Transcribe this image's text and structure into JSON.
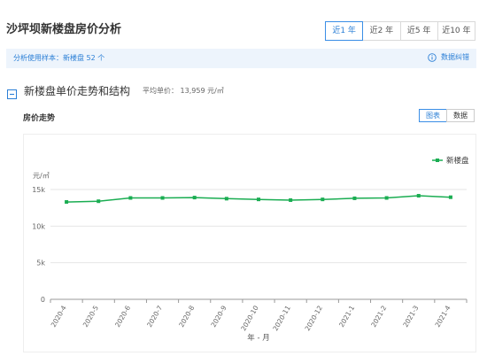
{
  "page": {
    "title": "沙坪坝新楼盘房价分析"
  },
  "range_tabs": [
    {
      "label": "近1 年",
      "active": true
    },
    {
      "label": "近2 年",
      "active": false
    },
    {
      "label": "近5 年",
      "active": false
    },
    {
      "label": "近10 年",
      "active": false
    }
  ],
  "info_bar": {
    "sample_text": "分析使用样本：新楼盘 52 个",
    "feedback_label": "数据纠错",
    "feedback_icon": "info-circle-icon"
  },
  "section": {
    "title": "新楼盘单价走势和结构",
    "collapse_icon": "collapse-minus-icon",
    "avg_price": "平均单价：  13,959 元/㎡"
  },
  "chart_panel": {
    "label": "房价走势",
    "view_buttons": [
      {
        "label": "图表",
        "active": true
      },
      {
        "label": "数据",
        "active": false
      }
    ]
  },
  "colors": {
    "accent": "#2b7fd6",
    "series": "#1aad52",
    "info_bg": "#edf4fc"
  },
  "chart_data": {
    "type": "line",
    "title": "",
    "xlabel": "年 - 月",
    "ylabel": "元/㎡",
    "categories": [
      "2020-4",
      "2020-5",
      "2020-6",
      "2020-7",
      "2020-8",
      "2020-9",
      "2020-10",
      "2020-11",
      "2020-12",
      "2021-1",
      "2021-2",
      "2021-3",
      "2021-4"
    ],
    "series": [
      {
        "name": "新楼盘",
        "values": [
          13300,
          13400,
          13850,
          13850,
          13900,
          13750,
          13650,
          13550,
          13650,
          13800,
          13850,
          14150,
          13950
        ]
      }
    ],
    "ylim": [
      0,
      15000
    ],
    "yticks": [
      0,
      5000,
      10000,
      15000
    ],
    "ytick_labels": [
      "0",
      "5k",
      "10k",
      "15k"
    ],
    "grid": true,
    "legend": "top-right"
  }
}
